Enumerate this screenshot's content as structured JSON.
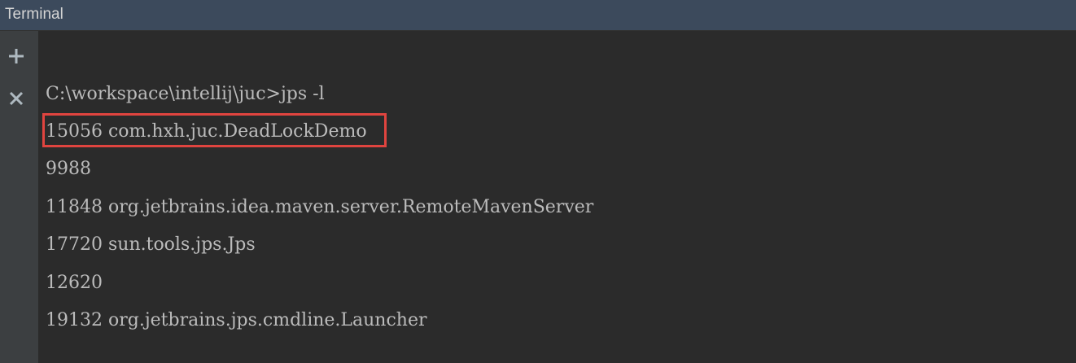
{
  "window": {
    "title": "Terminal"
  },
  "toolbar": {
    "new_session_icon": "plus-icon",
    "close_session_icon": "close-icon"
  },
  "terminal": {
    "lines": [
      "C:\\workspace\\intellij\\juc>jps -l",
      "15056 com.hxh.juc.DeadLockDemo",
      "9988",
      "11848 org.jetbrains.idea.maven.server.RemoteMavenServer",
      "17720 sun.tools.jps.Jps",
      "12620",
      "19132 org.jetbrains.jps.cmdline.Launcher"
    ],
    "highlighted_line_index": 1
  },
  "colors": {
    "title_bar": "#3c4a5c",
    "background": "#2b2b2b",
    "text": "#bbbbbb",
    "highlight_border": "#e0443f"
  }
}
